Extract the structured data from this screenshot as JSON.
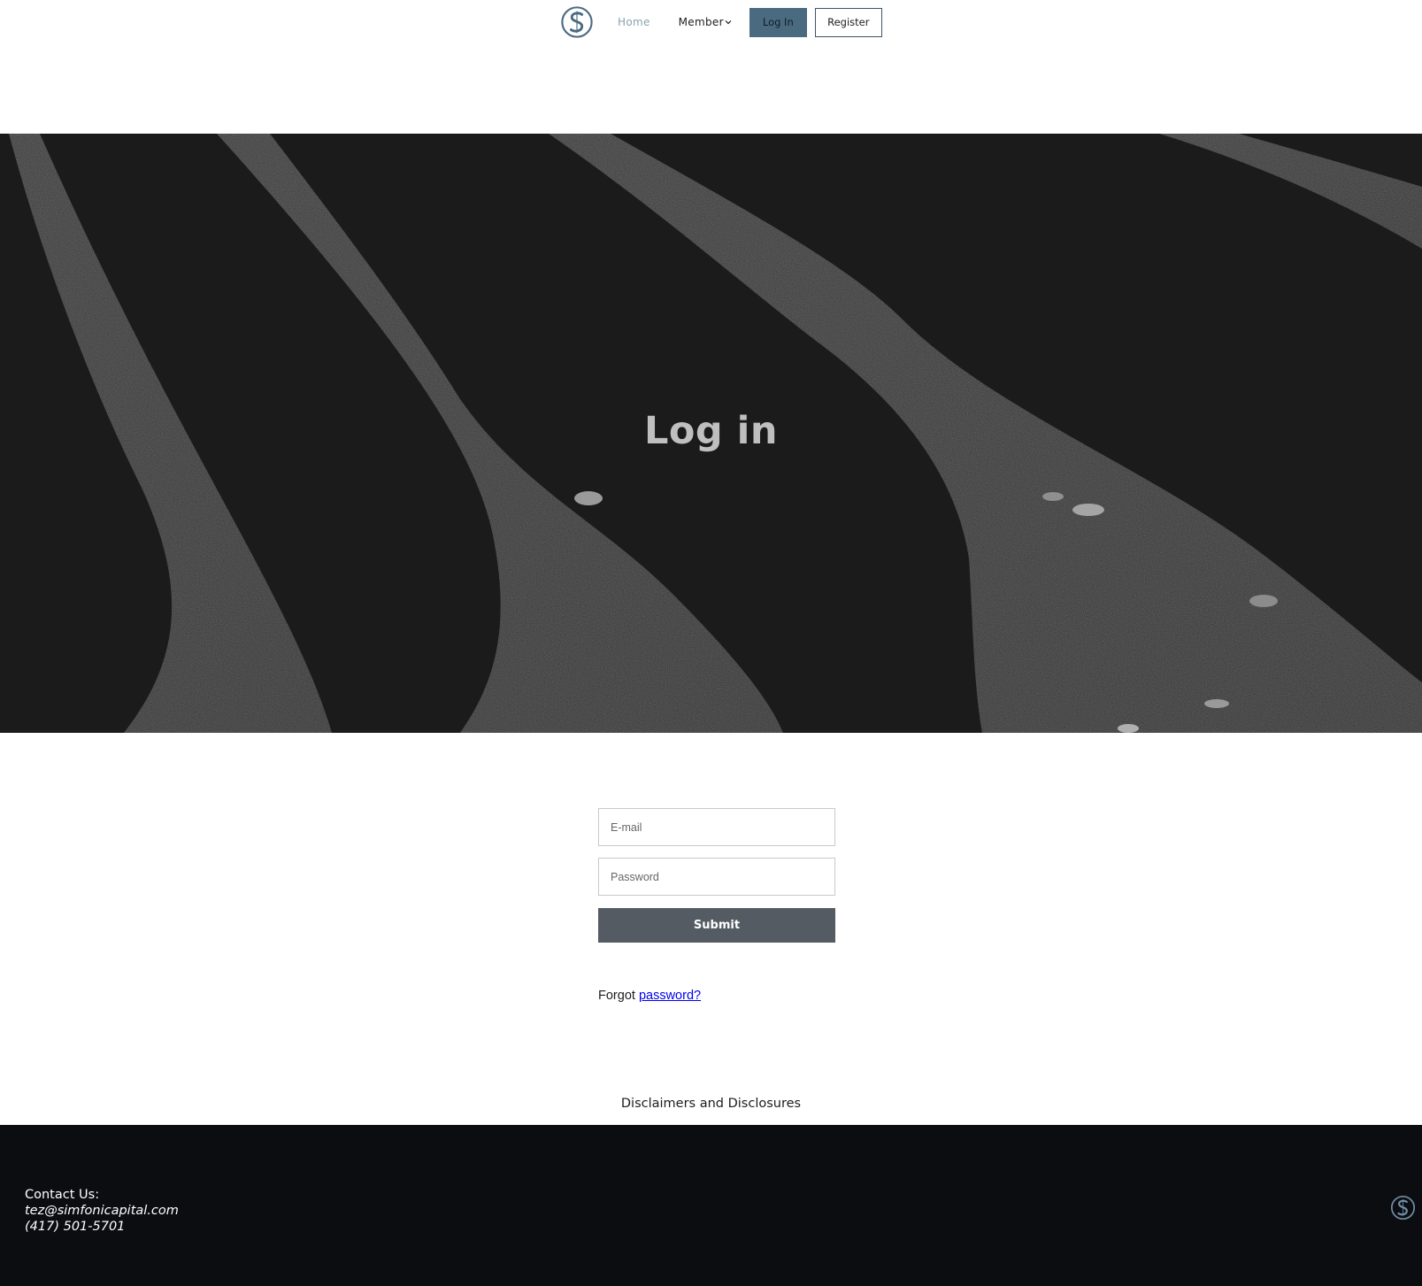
{
  "header": {
    "logo_icon": "simfonic-s-logo-icon",
    "nav": {
      "home_label": "Home",
      "member_label": "Member",
      "member_icon": "chevron-down-icon"
    },
    "login_label": "Log In",
    "register_label": "Register"
  },
  "hero": {
    "title": "Log in"
  },
  "form": {
    "email_placeholder": "E-mail",
    "password_placeholder": "Password",
    "submit_label": "Submit",
    "forgot_prefix": "Forgot",
    "forgot_link": "password?"
  },
  "disclaimers_label": "Disclaimers and Disclosures",
  "footer": {
    "contact_heading": "Contact Us:",
    "email": "tez@simfonicapital.com",
    "phone": "(417) 501-5701",
    "logo_icon": "simfonic-s-logo-icon"
  },
  "colors": {
    "accent": "#4a6a80",
    "home_link": "#8aa3b0",
    "hero_bg": "#1c1c1d",
    "submit_bg": "#545b63",
    "footer_bg": "#0c0d10"
  }
}
